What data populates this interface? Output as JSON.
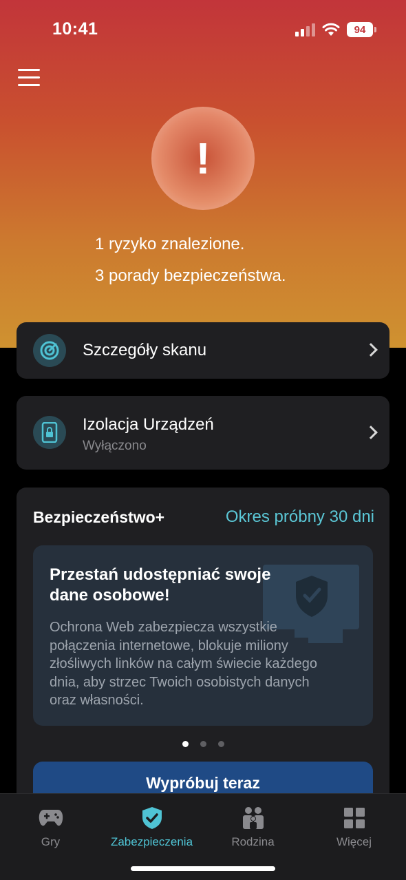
{
  "status_bar": {
    "time": "10:41",
    "battery": "94"
  },
  "hero": {
    "alert_symbol": "!",
    "line1": "1 ryzyko znalezione.",
    "line2": "3 porady bezpieczeństwa."
  },
  "scan_details": {
    "label": "Szczegóły skanu",
    "icon": "radar-icon"
  },
  "device_isolation": {
    "label": "Izolacja Urządzeń",
    "status": "Wyłączono",
    "icon": "lock-device-icon"
  },
  "security_plus": {
    "title": "Bezpieczeństwo+",
    "trial": "Okres próbny 30 dni",
    "promo": {
      "title": "Przestań udostępniać swoje dane osobowe!",
      "text": "Ochrona Web zabezpiecza wszystkie połączenia internetowe, blokuje miliony złośliwych linków na całym świecie każdego dnia, aby strzec Twoich osobistych danych oraz własności."
    },
    "carousel": {
      "current": 1,
      "total": 3
    },
    "button_label": "Wypróbuj teraz"
  },
  "tab_bar": {
    "tabs": [
      {
        "label": "Gry",
        "icon": "gamepad-icon",
        "active": false
      },
      {
        "label": "Zabezpieczenia",
        "icon": "shield-check-icon",
        "active": true
      },
      {
        "label": "Rodzina",
        "icon": "family-icon",
        "active": false
      },
      {
        "label": "Więcej",
        "icon": "grid-icon",
        "active": false
      }
    ]
  },
  "colors": {
    "accent": "#5bc7d6",
    "hero_top": "#c2353a",
    "hero_bottom": "#cf9230",
    "button": "#1f4a85",
    "card": "#1f1f22"
  }
}
